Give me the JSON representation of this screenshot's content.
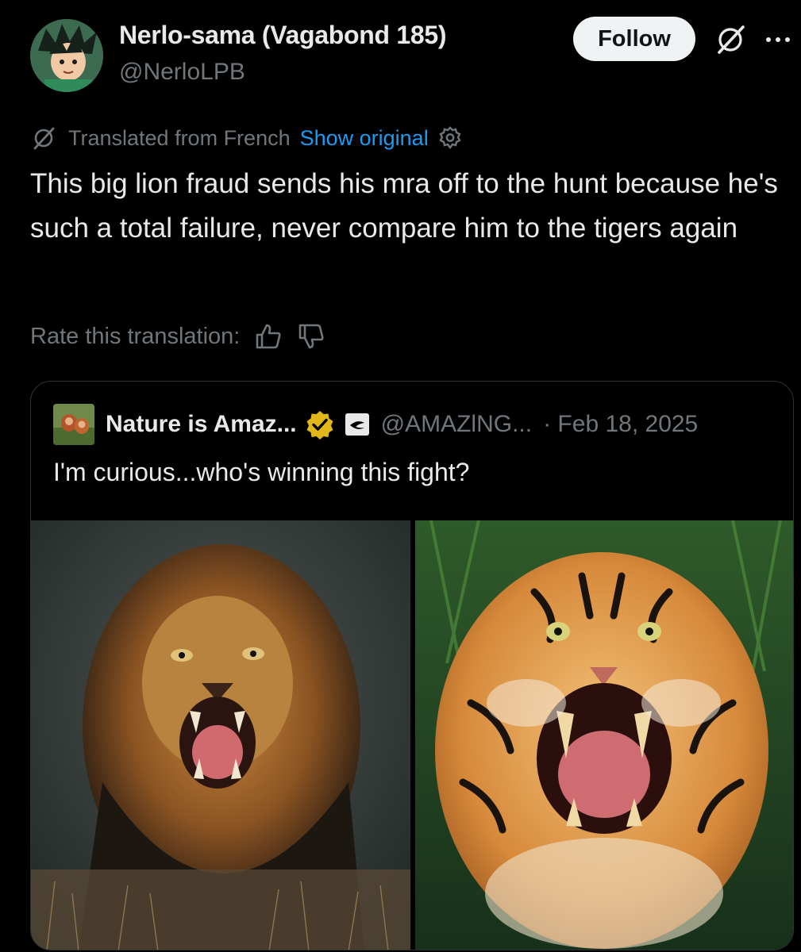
{
  "post": {
    "author": {
      "display_name": "Nerlo-sama (Vagabond 185)",
      "handle": "@NerloLPB",
      "avatar_icon": "anime-avatar"
    },
    "follow_label": "Follow",
    "grok_icon": "grok-icon",
    "more_icon": "more-options-icon",
    "translation": {
      "label": "Translated from French",
      "show_original": "Show original",
      "settings_icon": "gear-icon"
    },
    "text": "This big lion fraud sends his mra off to the hunt because he's such a total failure, never compare him to the tigers again",
    "rate": {
      "label": "Rate this translation:",
      "up_icon": "thumbs-up-icon",
      "down_icon": "thumbs-down-icon"
    }
  },
  "quote": {
    "author": {
      "display_name": "Nature is Amaz...",
      "handle": "@AMAZlNG...",
      "date": "· Feb 18, 2025",
      "verified_icon": "verified-gold-badge-icon",
      "affiliation_icon": "affiliate-badge-icon"
    },
    "text": "I'm curious...who's winning this fight?",
    "media": [
      "roaring-lion-photo",
      "roaring-tiger-photo"
    ]
  },
  "colors": {
    "background": "#000000",
    "primary_text": "#e7e9ea",
    "secondary_text": "#71767b",
    "link": "#1d9bf0",
    "follow_bg": "#eff3f4",
    "border": "#2f3336",
    "verified_gold": "#e2b719"
  }
}
